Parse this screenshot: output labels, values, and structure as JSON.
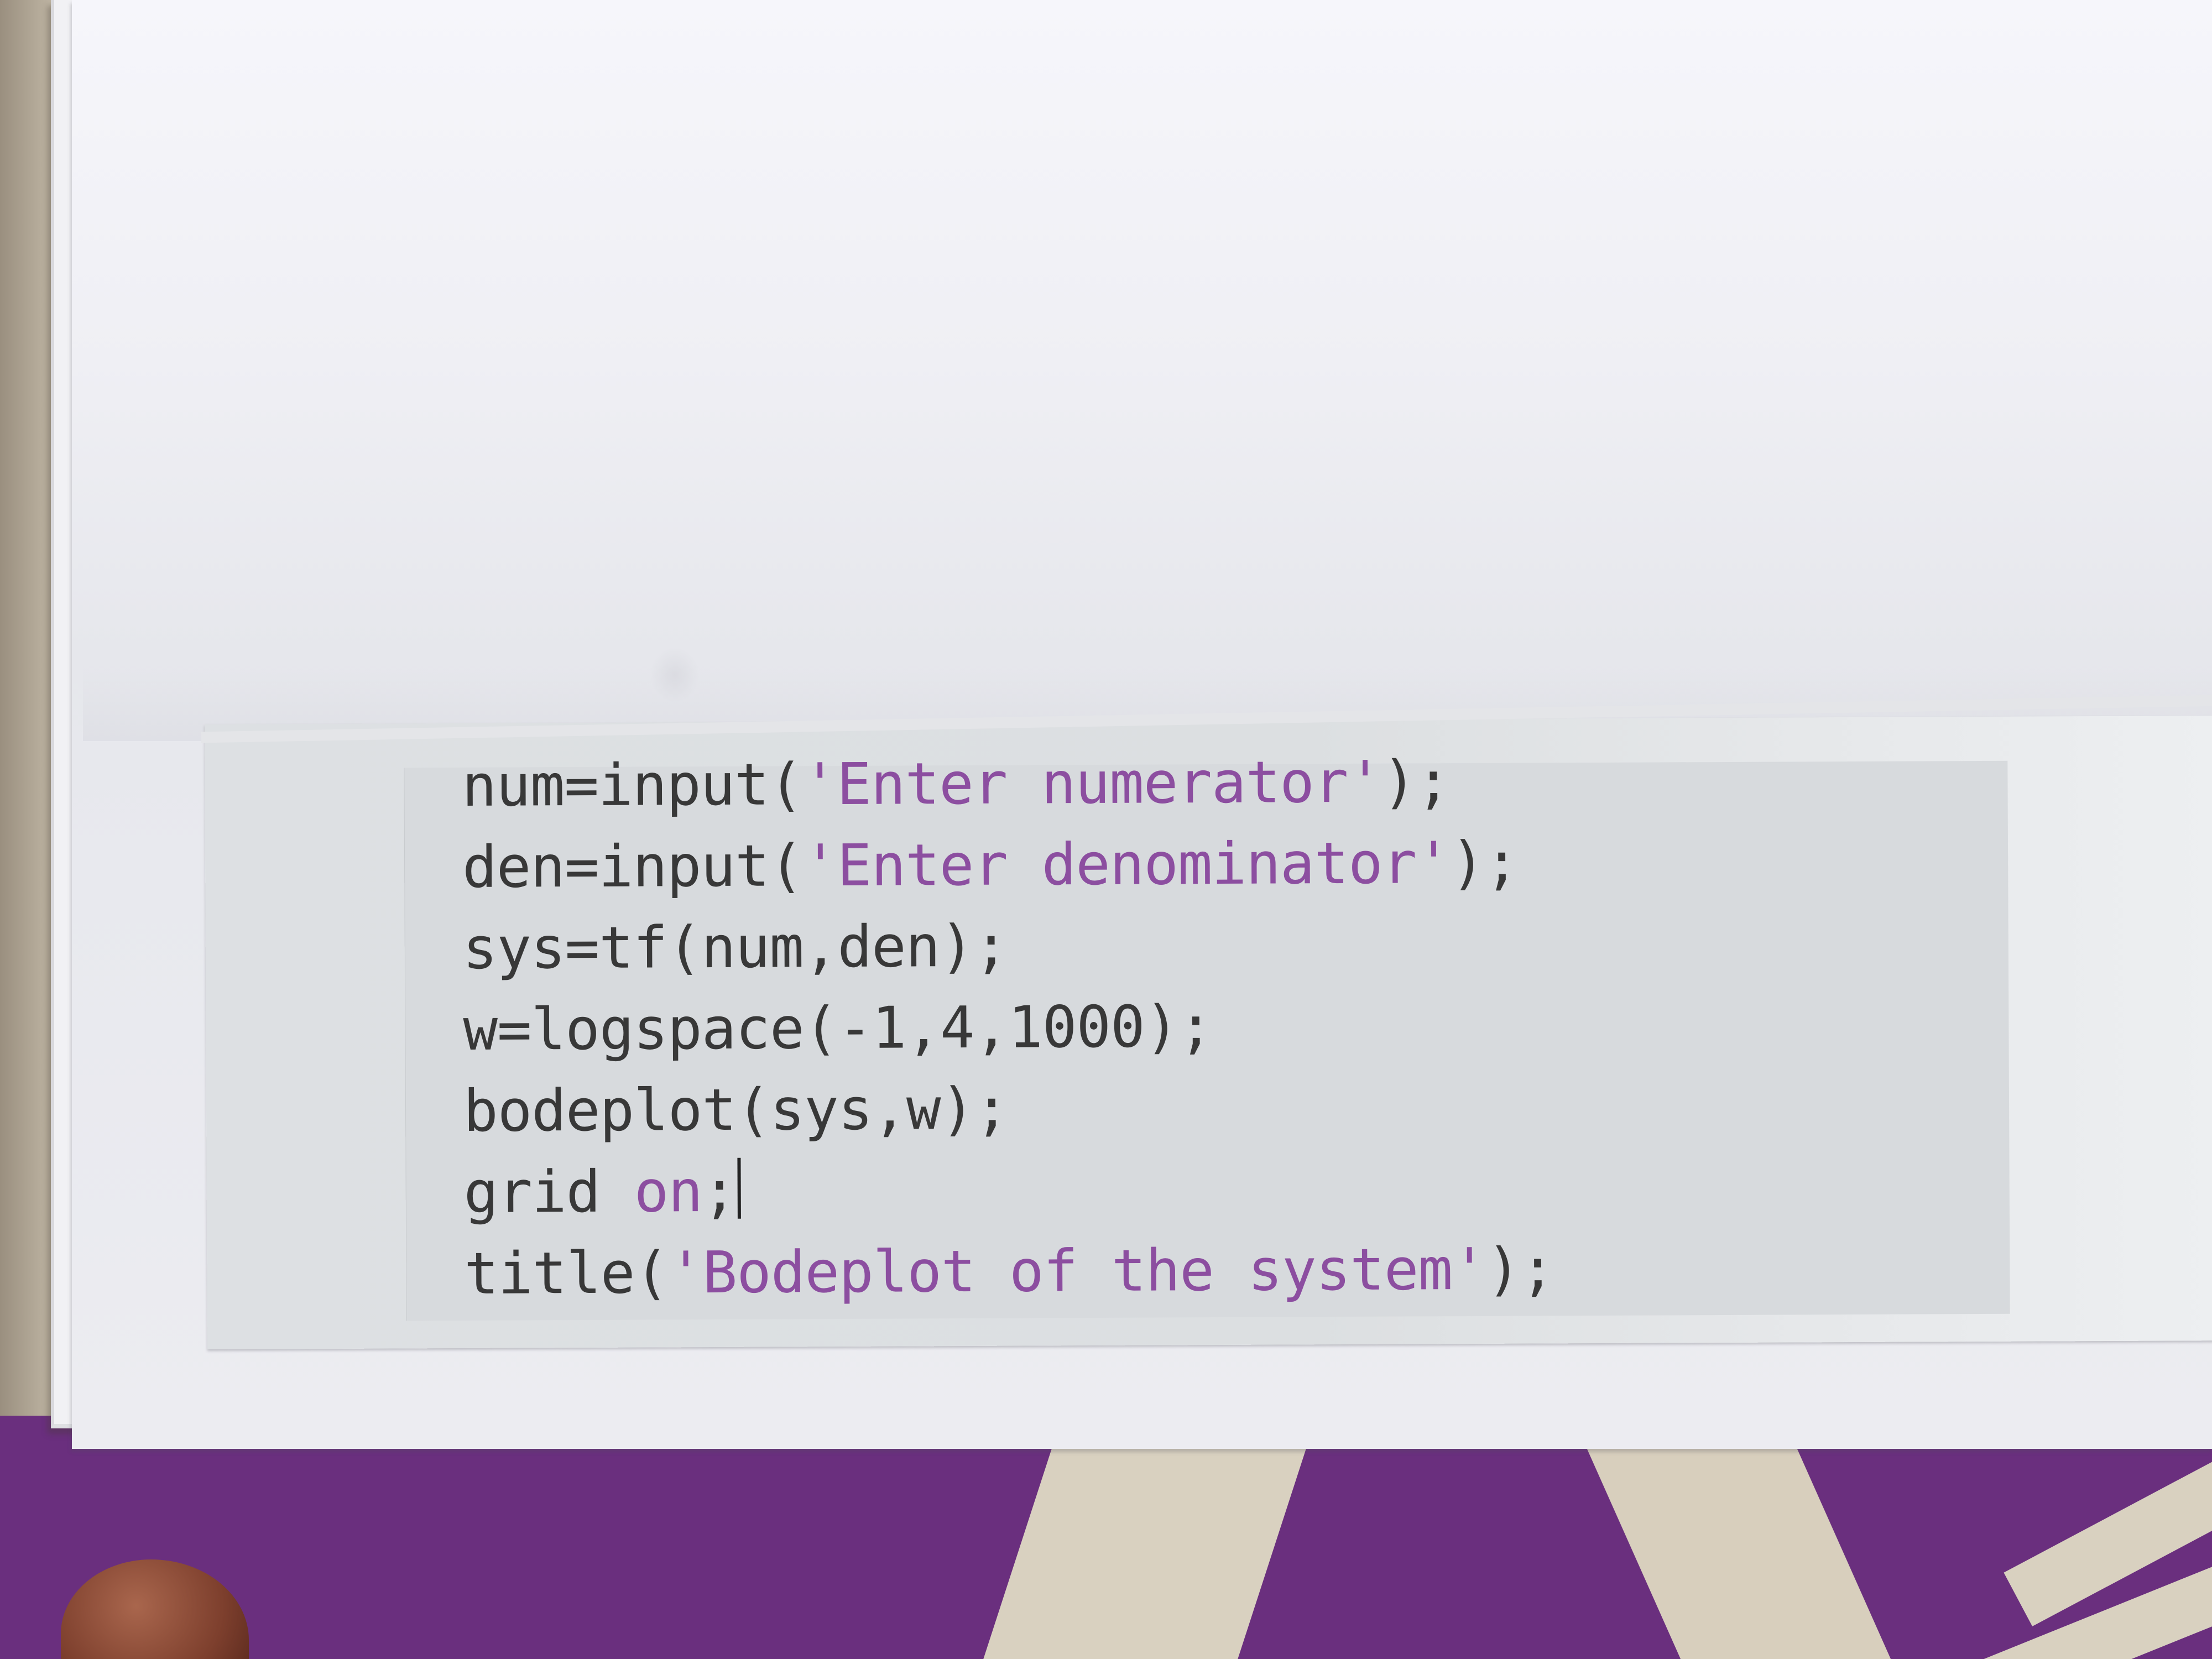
{
  "code": {
    "lines": [
      [
        {
          "text": "num=input(",
          "cls": "plain"
        },
        {
          "text": "'Enter numerator'",
          "cls": "str"
        },
        {
          "text": ");",
          "cls": "plain"
        }
      ],
      [
        {
          "text": "den=input(",
          "cls": "plain"
        },
        {
          "text": "'Enter denominator'",
          "cls": "str"
        },
        {
          "text": ");",
          "cls": "plain"
        }
      ],
      [
        {
          "text": "sys=tf(num,den);",
          "cls": "plain"
        }
      ],
      [
        {
          "text": "w=logspace(-1,4,1000);",
          "cls": "plain"
        }
      ],
      [
        {
          "text": "bodeplot(sys,w);",
          "cls": "plain"
        }
      ],
      [
        {
          "text": "grid ",
          "cls": "plain"
        },
        {
          "text": "on",
          "cls": "kw"
        },
        {
          "text": ";",
          "cls": "plain"
        },
        {
          "text": "",
          "cls": "cursor"
        }
      ],
      [
        {
          "text": "title(",
          "cls": "plain"
        },
        {
          "text": "'Bodeplot of the system'",
          "cls": "str"
        },
        {
          "text": ");",
          "cls": "plain"
        }
      ]
    ]
  },
  "colors": {
    "code_text": "#383838",
    "string_literal": "#8c4ea0",
    "code_background": "#d7dadd",
    "cloth_purple": "#6a2f7e"
  }
}
